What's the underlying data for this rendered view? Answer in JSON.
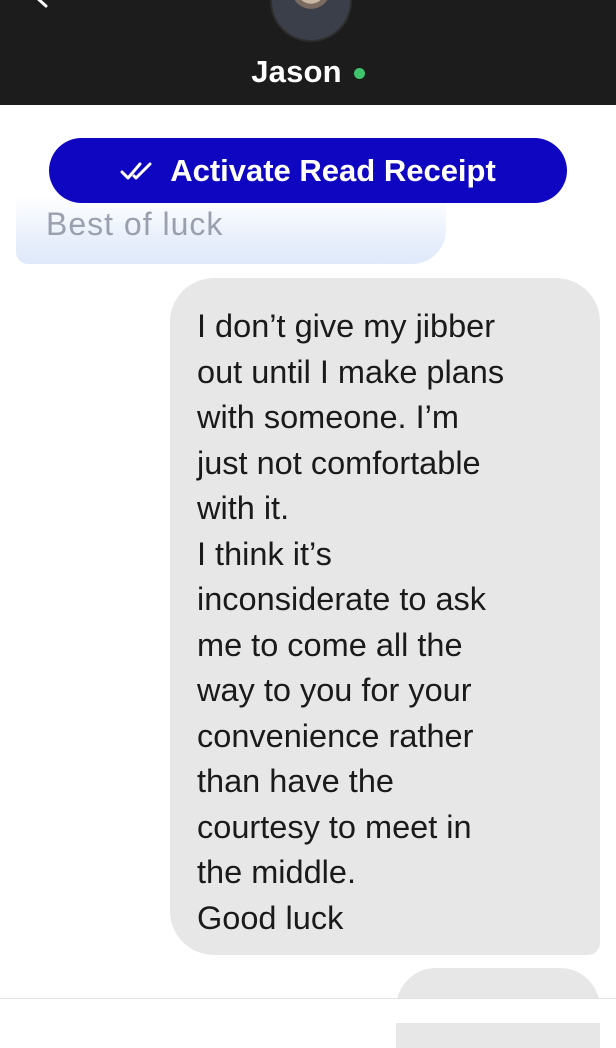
{
  "header": {
    "contact_name": "Jason",
    "status": "online",
    "status_color": "#3ec46d",
    "background": "#1c1c1c"
  },
  "receipt_button": {
    "label": "Activate Read Receipt",
    "icon": "double-check-icon",
    "color": "#0f06c2"
  },
  "messages": [
    {
      "direction": "received",
      "text": "Best of luck",
      "partially_visible": true
    },
    {
      "direction": "sent",
      "text": "I don’t give my jibber\nout until I make plans\nwith someone. I’m\njust not comfortable\nwith it.\nI think it’s\ninconsiderate to ask\nme to come all the\nway to you for your\nconvenience rather\nthan have the\ncourtesy to meet in\nthe middle.\nGood luck"
    }
  ]
}
